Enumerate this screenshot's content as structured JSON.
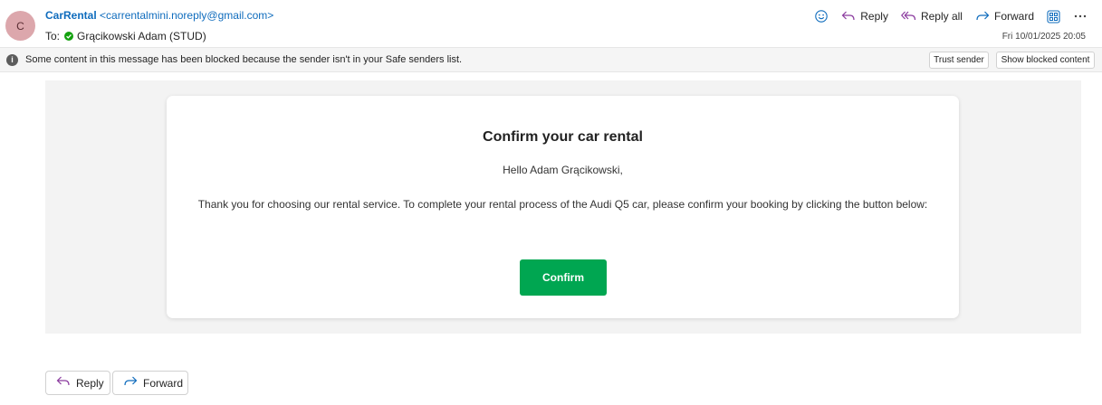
{
  "header": {
    "avatar_initial": "C",
    "sender_name": "CarRental",
    "sender_email": "<carrentalmini.noreply@gmail.com>",
    "to_label": "To:",
    "recipient": "Grącikowski Adam (STUD)",
    "date": "Fri 10/01/2025 20:05",
    "actions": {
      "reply": "Reply",
      "reply_all": "Reply all",
      "forward": "Forward"
    },
    "icons": [
      "emoji-icon",
      "reply-icon",
      "reply-all-icon",
      "forward-icon",
      "apps-icon",
      "more-icon"
    ]
  },
  "infobar": {
    "icon": "info-icon",
    "message": "Some content in this message has been blocked because the sender isn't in your Safe senders list.",
    "trust_sender": "Trust sender",
    "show_blocked": "Show blocked content"
  },
  "email_body": {
    "title": "Confirm your car rental",
    "greeting": "Hello Adam Grącikowski,",
    "text": "Thank you for choosing our rental service. To complete your rental process of the Audi Q5 car, please confirm your booking by clicking the button below:",
    "button_label": "Confirm"
  },
  "footer": {
    "reply": "Reply",
    "forward": "Forward"
  },
  "colors": {
    "accent_link": "#0f6cbd",
    "reply_icon": "#8a3a9e",
    "forward_icon": "#0f6cbd",
    "confirm_button": "#00a651",
    "verified_check": "#13a10e",
    "avatar_bg": "#dca7ac"
  }
}
